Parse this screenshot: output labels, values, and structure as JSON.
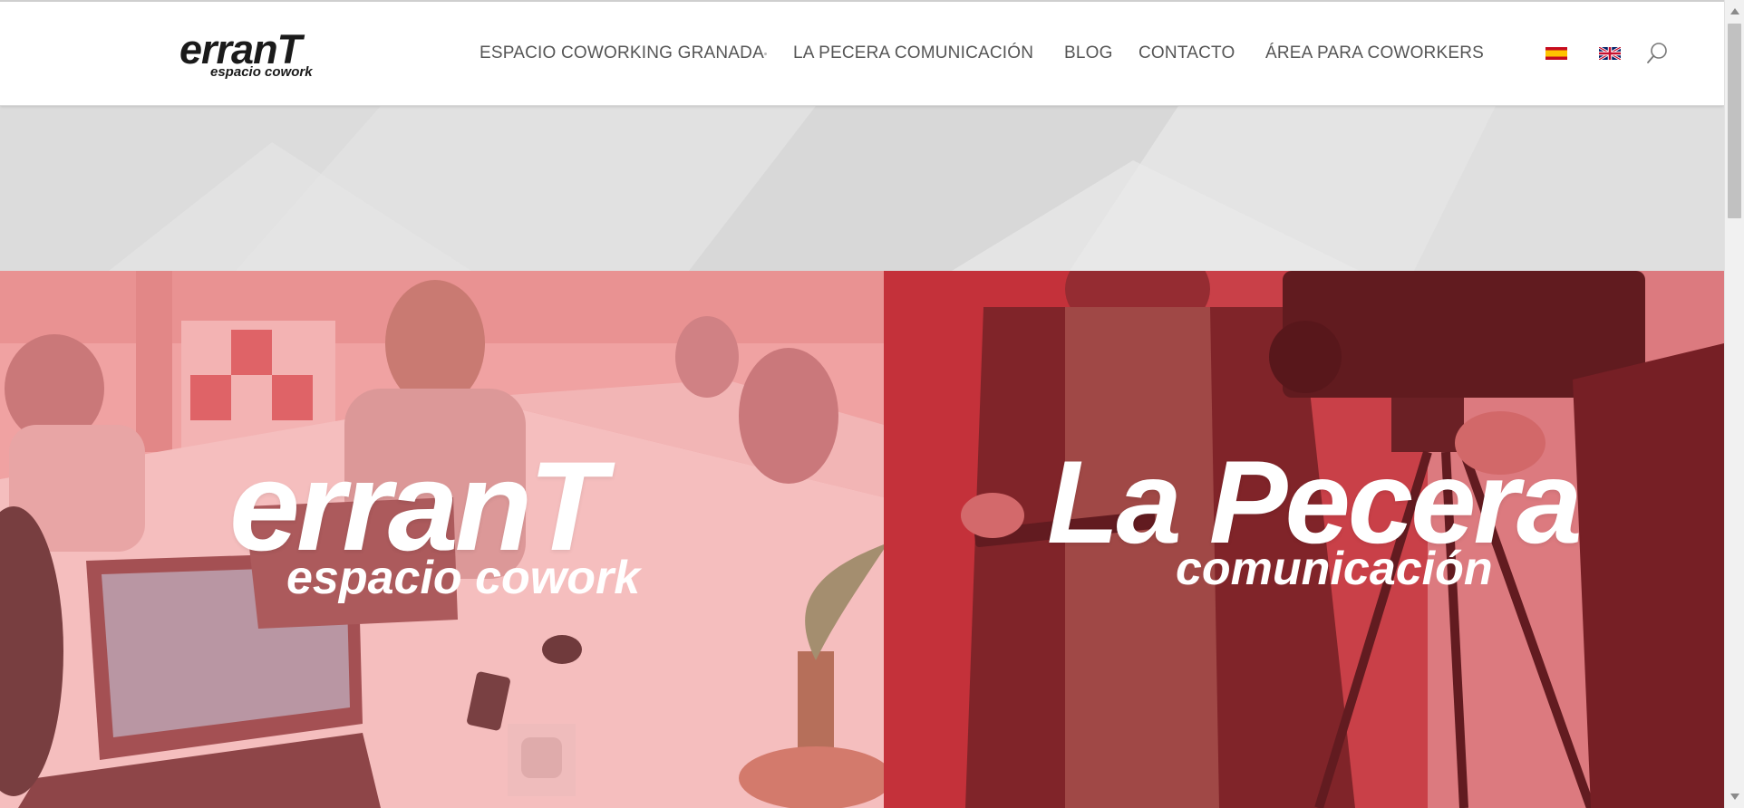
{
  "header": {
    "logo": {
      "main": "erranT",
      "sub": "espacio cowork"
    },
    "nav": [
      {
        "label": "ESPACIO COWORKING GRANADA"
      },
      {
        "label": "LA PECERA COMUNICACIÓN"
      },
      {
        "label": "BLOG"
      },
      {
        "label": "CONTACTO"
      },
      {
        "label": "ÁREA PARA COWORKERS"
      }
    ],
    "languages": [
      {
        "name": "Español",
        "icon": "spain-flag-icon"
      },
      {
        "name": "English",
        "icon": "uk-flag-icon"
      }
    ],
    "search_icon": "search-icon"
  },
  "panels": [
    {
      "title": "erranT",
      "subtitle": "espacio cowork",
      "tint": "#f08a8a"
    },
    {
      "title": "La Pecera",
      "subtitle": "comunicación",
      "tint": "#c8353c"
    }
  ],
  "colors": {
    "nav_text": "#555555",
    "panel_left_tint": "#f08a8a",
    "panel_right_tint": "#c8353c",
    "hero_bg": "#e0e0e0"
  }
}
